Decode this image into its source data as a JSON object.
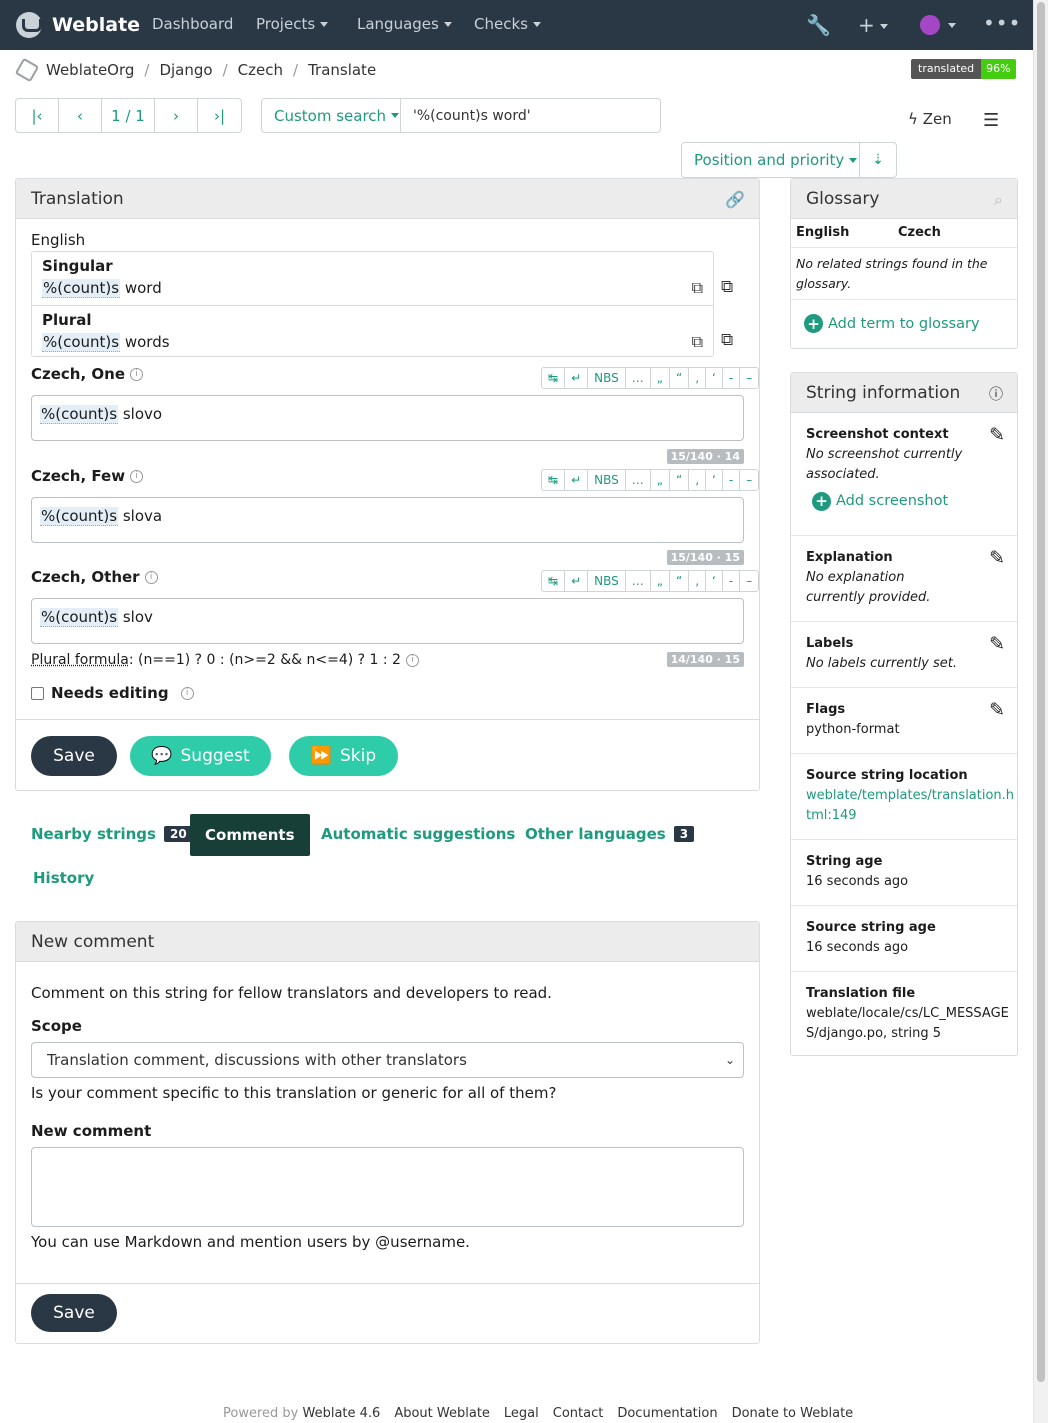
{
  "navbar": {
    "brand": "Weblate",
    "items": [
      "Dashboard",
      "Projects",
      "Languages",
      "Checks"
    ]
  },
  "breadcrumb": [
    "WeblateOrg",
    "Django",
    "Czech",
    "Translate"
  ],
  "badge": {
    "label": "translated",
    "value": "96%"
  },
  "pager": {
    "count": "1 / 1"
  },
  "search": {
    "mode": "Custom search",
    "query": "'%(count)s word'"
  },
  "zen": "Zen",
  "sort": {
    "label": "Position and priority"
  },
  "translation": {
    "title": "Translation",
    "source_language": "English",
    "source": [
      {
        "label": "Singular",
        "placeholder": "%(count)s",
        "text": " word"
      },
      {
        "label": "Plural",
        "placeholder": "%(count)s",
        "text": " words"
      }
    ],
    "toolbar": [
      "↹",
      "↵",
      "NBS",
      "…",
      "„",
      "“",
      "‚",
      "‘",
      "-",
      "–"
    ],
    "targets": [
      {
        "label": "Czech, One",
        "placeholder": "%(count)s",
        "text": " slovo",
        "counter": "15/140 · 14"
      },
      {
        "label": "Czech, Few",
        "placeholder": "%(count)s",
        "text": " slova",
        "counter": "15/140 · 15"
      },
      {
        "label": "Czech, Other",
        "placeholder": "%(count)s",
        "text": " slov",
        "counter": "14/140 · 15"
      }
    ],
    "formula_label": "Plural formula",
    "formula": ": (n==1) ? 0 : (n>=2 && n<=4) ? 1 : 2",
    "needs_editing": "Needs editing",
    "buttons": {
      "save": "Save",
      "suggest": "Suggest",
      "skip": "Skip"
    }
  },
  "tabs": [
    {
      "label": "Nearby strings",
      "count": "20"
    },
    {
      "label": "Comments"
    },
    {
      "label": "Automatic suggestions"
    },
    {
      "label": "Other languages",
      "count": "3"
    },
    {
      "label": "History"
    }
  ],
  "comment": {
    "title": "New comment",
    "intro": "Comment on this string for fellow translators and developers to read.",
    "scope_label": "Scope",
    "scope_value": "Translation comment, discussions with other translators",
    "scope_help": "Is your comment specific to this translation or generic for all of them?",
    "comment_label": "New comment",
    "markdown_help": "You can use Markdown and mention users by @username.",
    "save": "Save"
  },
  "glossary": {
    "title": "Glossary",
    "col_source": "English",
    "col_target": "Czech",
    "empty": "No related strings found in the glossary.",
    "add": "Add term to glossary"
  },
  "string_info": {
    "title": "String information",
    "screenshot_title": "Screenshot context",
    "screenshot_text": "No screenshot currently associated.",
    "add_screenshot": "Add screenshot",
    "explanation_title": "Explanation",
    "explanation_text": "No explanation currently provided.",
    "labels_title": "Labels",
    "labels_text": "No labels currently set.",
    "flags_title": "Flags",
    "flags_text": "python-format",
    "location_title": "Source string location",
    "location_link_1": "weblate/templates/translation.h",
    "location_link_2": "tml:149",
    "age_title": "String age",
    "age_text": "16 seconds ago",
    "source_age_title": "Source string age",
    "source_age_text": "16 seconds ago",
    "file_title": "Translation file",
    "file_text_1": "weblate/locale/cs/LC_MESSAGE",
    "file_text_2": "S/django.po, string 5"
  },
  "footer": {
    "powered": "Powered by",
    "version": "Weblate 4.6",
    "links": [
      "About Weblate",
      "Legal",
      "Contact",
      "Documentation",
      "Donate to Weblate"
    ]
  },
  "colors": {
    "accent": "#1e9a7e",
    "navbar": "#2a3744",
    "green_button": "#2ecca9"
  }
}
